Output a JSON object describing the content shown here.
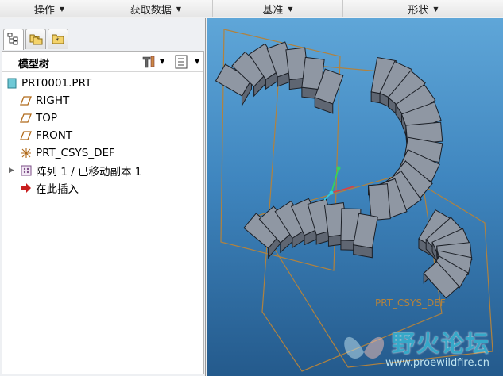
{
  "menubar": {
    "items": [
      "操作",
      "获取数据",
      "基准",
      "形状"
    ]
  },
  "left_panel": {
    "tabs": [
      {
        "icon": "model-tree-tab-icon"
      },
      {
        "icon": "folder-browser-tab-icon"
      },
      {
        "icon": "favorites-tab-icon"
      }
    ],
    "tree_title": "模型树",
    "tools": {
      "settings_icon": "tree-settings-icon",
      "columns_icon": "tree-columns-icon"
    },
    "tree": [
      {
        "label": "PRT0001.PRT",
        "icon": "part-icon"
      },
      {
        "label": "RIGHT",
        "icon": "datum-plane-icon"
      },
      {
        "label": "TOP",
        "icon": "datum-plane-icon"
      },
      {
        "label": "FRONT",
        "icon": "datum-plane-icon"
      },
      {
        "label": "PRT_CSYS_DEF",
        "icon": "coordinate-system-icon"
      },
      {
        "label": "阵列 1 / 已移动副本 1",
        "icon": "pattern-icon",
        "expander": "▶"
      },
      {
        "label": "在此插入",
        "icon": "insert-here-arrow-icon"
      }
    ]
  },
  "viewport": {
    "csys_label": "PRT_CSYS_DEF",
    "colors": {
      "background_top": "#5fa6d8",
      "background_bottom": "#245a8c",
      "datum": "#b0823f",
      "solid": "#8e96a2"
    }
  },
  "watermark": {
    "title": "野火论坛",
    "url": "www.proewildfire.cn"
  }
}
